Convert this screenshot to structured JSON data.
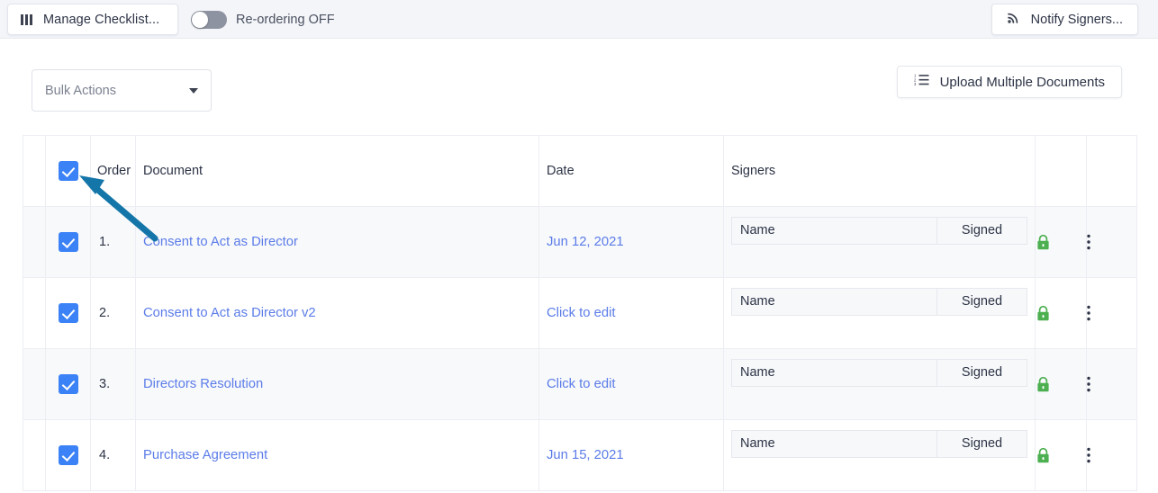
{
  "topbar": {
    "manage_checklist_label": "Manage Checklist...",
    "manage_checklist_icon": "columns-icon",
    "reordering_label": "Re-ordering OFF",
    "reordering_state": "off",
    "notify_label": "Notify Signers...",
    "notify_icon": "broadcast-icon"
  },
  "actions": {
    "bulk_actions_label": "Bulk Actions",
    "bulk_actions_caret": "chevron-down-icon",
    "upload_label": "Upload Multiple Documents",
    "upload_icon": "ordered-list-icon"
  },
  "table": {
    "headers": {
      "grip": "",
      "check": "",
      "order": "Order",
      "document": "Document",
      "date": "Date",
      "signers": "Signers",
      "lock": "",
      "menu": ""
    },
    "header_checkbox_checked": true,
    "signer_columns": {
      "name": "Name",
      "status": "Signed"
    },
    "rows": [
      {
        "checked": true,
        "order": "1.",
        "document": "Consent to Act as Director",
        "date": "Jun 12, 2021",
        "signer_name": "Name",
        "signer_status": "Signed",
        "lock": "lock-closed-icon",
        "menu": "more-vertical-icon"
      },
      {
        "checked": true,
        "order": "2.",
        "document": "Consent to Act as Director v2",
        "date": "Click to edit",
        "signer_name": "Name",
        "signer_status": "Signed",
        "lock": "lock-closed-icon",
        "menu": "more-vertical-icon"
      },
      {
        "checked": true,
        "order": "3.",
        "document": "Directors Resolution",
        "date": "Click to edit",
        "signer_name": "Name",
        "signer_status": "Signed",
        "lock": "lock-closed-icon",
        "menu": "more-vertical-icon"
      },
      {
        "checked": true,
        "order": "4.",
        "document": "Purchase Agreement",
        "date": "Jun 15, 2021",
        "signer_name": "Name",
        "signer_status": "Signed",
        "lock": "lock-closed-icon",
        "menu": "more-vertical-icon"
      }
    ]
  },
  "colors": {
    "checkbox_blue": "#3b82f6",
    "link_blue": "#5b7ce8",
    "lock_green": "#4caf50",
    "annotation_blue": "#1476a8",
    "topbar_bg": "#f4f5f9",
    "row_shade": "#f8f9fb"
  },
  "annotation": {
    "type": "arrow",
    "target": "header-select-all-checkbox"
  }
}
